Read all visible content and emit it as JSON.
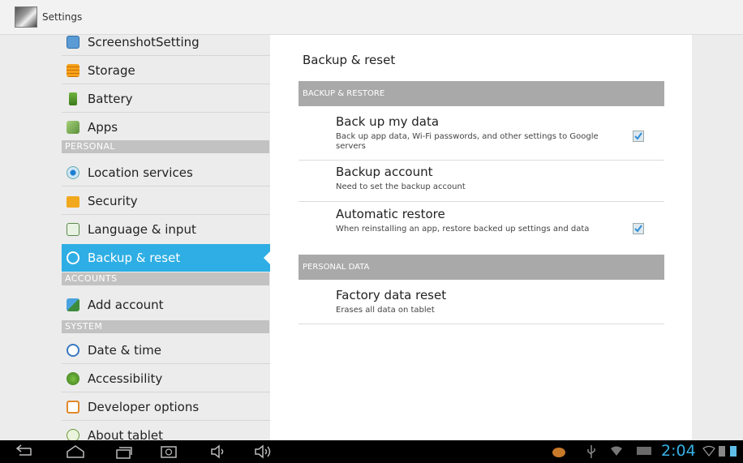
{
  "app": {
    "title": "Settings"
  },
  "sidebar": {
    "items": [
      {
        "label": "ScreenshotSetting",
        "icon": "screenshot-icon"
      },
      {
        "label": "Storage",
        "icon": "storage-icon"
      },
      {
        "label": "Battery",
        "icon": "battery-icon"
      },
      {
        "label": "Apps",
        "icon": "apps-icon"
      },
      {
        "label": "Location services",
        "icon": "location-icon"
      },
      {
        "label": "Security",
        "icon": "lock-icon"
      },
      {
        "label": "Language & input",
        "icon": "language-icon"
      },
      {
        "label": "Backup & reset",
        "icon": "backup-icon"
      },
      {
        "label": "Add account",
        "icon": "add-account-icon"
      },
      {
        "label": "Date & time",
        "icon": "clock-icon"
      },
      {
        "label": "Accessibility",
        "icon": "accessibility-icon"
      },
      {
        "label": "Developer options",
        "icon": "developer-icon"
      },
      {
        "label": "About tablet",
        "icon": "info-icon"
      }
    ],
    "headers": {
      "personal": "PERSONAL",
      "accounts": "ACCOUNTS",
      "system": "SYSTEM"
    },
    "active_index": 7
  },
  "content": {
    "title": "Backup & reset",
    "section_backup": "BACKUP & RESTORE",
    "section_personal": "PERSONAL DATA",
    "rows": [
      {
        "title": "Back up my data",
        "summary": "Back up app data, Wi-Fi passwords, and other settings to Google servers",
        "checked": true
      },
      {
        "title": "Backup account",
        "summary": "Need to set the backup account"
      },
      {
        "title": "Automatic restore",
        "summary": "When reinstalling an app, restore backed up settings and data",
        "checked": true
      },
      {
        "title": "Factory data reset",
        "summary": "Erases all data on tablet"
      }
    ]
  },
  "status": {
    "time": "2:04"
  },
  "colors": {
    "accent": "#2eaee4",
    "header_bg": "#a9a9a9",
    "clock": "#35b2e6"
  }
}
